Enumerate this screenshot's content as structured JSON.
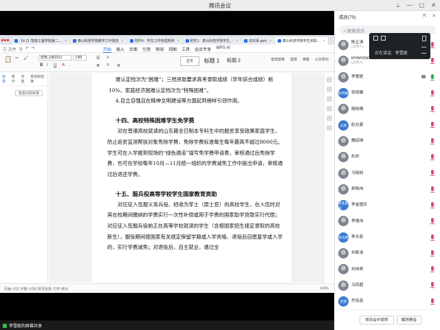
{
  "window": {
    "title": "腾讯会议"
  },
  "share_label": "李雪妮的屏幕共享",
  "wps": {
    "tabs": [
      {
        "label": "【4.1】智能工程学院第二…"
      },
      {
        "label": "泰山科技学院教学工作报告"
      },
      {
        "label": "附件4：学生工作管理条例"
      },
      {
        "label": "附件1：泰山科技学院学生…"
      },
      {
        "label": "四天系.pptx"
      },
      {
        "label": "泰山科技学院学生资助…",
        "active": true
      }
    ],
    "file_menu": "三 文件",
    "menu": [
      "开始",
      "插入",
      "页面",
      "引用",
      "审阅",
      "视图",
      "工具",
      "会员专享",
      "WPS AI"
    ],
    "menu_active": "开始",
    "font_name": "仿宋_GB2312",
    "font_size": "小四",
    "style_normal": "正文",
    "style_h1": "标题 1",
    "style_h2": "标题 2",
    "ribbon_right": [
      "查找替换",
      "选择",
      "排版",
      "公文校对"
    ],
    "nav_tabs": [
      "目录",
      "章节",
      "书签",
      "查找和替换"
    ],
    "nav_active": "目录",
    "nav_button": "智能识别目录",
    "status_left": "页面: 6/11   字数: 5783   拼写检查: 打开   校对",
    "status_right": "100%"
  },
  "doc": {
    "lines": [
      "难认定档次为“困难”；三档资助要求高考录取成绩（学年综合成绩）前",
      "10%，家庭经济困难认定档次为“特殊困难”。",
      "4.自立自强且在精神文明建设等方面起到榜样引领作用。"
    ],
    "h14": "十四、高校特殊困难学生免学费",
    "p14": "对在普通高校就读的山东籍全日制本专科生中的脱贫享受政策家庭学生、防止返贫监测帮扶对象免除学费，免除学费标准每生每年最高不超过8000元。学生可在入学报到现场的“绿色通道”填写免学费申请表，审核通过后免除学费，也可在学校每年10月—11月统一组织的学费减免工作中提出申请，审核通过后退还学费。",
    "h15": "十五、服兵役高等学校学生国家教育资助",
    "p15": "对应征入伍服义务兵役、招收为军士（原士官）的高校学生，在入伍时对其在校期间缴纳的学费实行一次性补偿或用于学费的国家助学贷款实行代偿；对应征入伍服兵役前正在高等学校就读的学生（含按国家招生规定录取的高校新生），服役期间按国家有关规定保留学籍或入学资格、退役后自愿复学或入学的，实行学费减免；对退役后，自主就业，通过全"
  },
  "panel": {
    "title": "成员(70)",
    "search_placeholder": "搜索成员",
    "speaking_label": "正在讲话:",
    "speaker": "李雪妮",
    "buttons": [
      "修改会中昵称",
      "解除静音"
    ]
  },
  "members": [
    {
      "name": "陈正涛",
      "sub": "(主持人)",
      "av": "photo",
      "mic": "off"
    },
    {
      "name": "MYANSWER",
      "sub": "(主持人)",
      "av": "photo",
      "mic": "off"
    },
    {
      "name": "李雪妮",
      "sub": "",
      "av": "photo",
      "mic": "on",
      "cam": true
    },
    {
      "name": "张筠媛",
      "sub": "",
      "av": "张筠媛",
      "mic": "off"
    },
    {
      "name": "路晓晴",
      "sub": "",
      "av": "photo",
      "mic": "off"
    },
    {
      "name": "赵光景",
      "sub": "",
      "av": "光景",
      "mic": "off"
    },
    {
      "name": "魏琮琪",
      "sub": "",
      "av": "photo",
      "mic": "off"
    },
    {
      "name": "杜欣",
      "sub": "",
      "av": "photo",
      "mic": "off"
    },
    {
      "name": "马晓旭",
      "sub": "",
      "av": "photo",
      "mic": "off"
    },
    {
      "name": "郝晓伟",
      "sub": "",
      "av": "photo",
      "mic": "off"
    },
    {
      "name": "李金国庆",
      "sub": "",
      "av": "李金国庆",
      "mic": "off"
    },
    {
      "name": "李增伟",
      "sub": "",
      "av": "photo",
      "mic": "off"
    },
    {
      "name": "李光若",
      "sub": "",
      "av": "李光若",
      "mic": "off"
    },
    {
      "name": "刘家浩",
      "sub": "",
      "av": "photo",
      "mic": "off"
    },
    {
      "name": "刘伟男",
      "sub": "",
      "av": "photo",
      "mic": "off"
    },
    {
      "name": "马凤超",
      "sub": "",
      "av": "photo",
      "mic": "off"
    },
    {
      "name": "乔佳苗",
      "sub": "",
      "av": "佳苗",
      "mic": "off"
    }
  ],
  "colors": {
    "accent": "#2b6de0",
    "mic_muted": "#e0457b",
    "mic_on": "#2ea44f",
    "avatar": "#3a7bd5"
  }
}
